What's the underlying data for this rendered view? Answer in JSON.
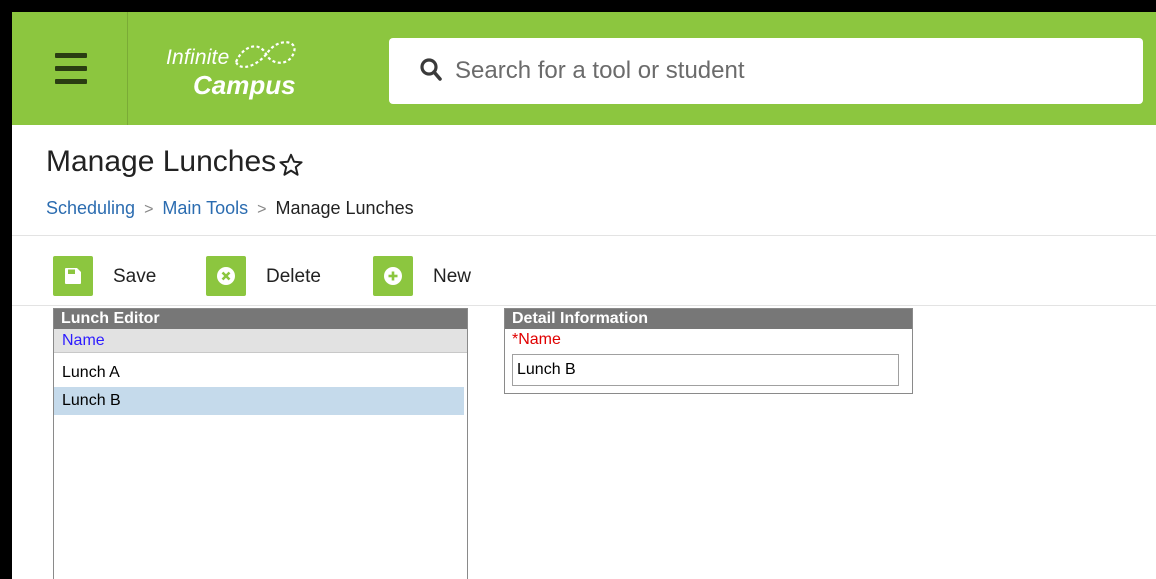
{
  "header": {
    "logo_line1": "Infinite",
    "logo_line2": "Campus",
    "search_placeholder": "Search for a tool or student",
    "brand_color": "#8cc63f"
  },
  "page": {
    "title": "Manage Lunches",
    "breadcrumb": [
      "Scheduling",
      "Main Tools",
      "Manage Lunches"
    ]
  },
  "toolbar": {
    "save_label": "Save",
    "delete_label": "Delete",
    "new_label": "New"
  },
  "lunch_editor": {
    "title": "Lunch Editor",
    "column_header": "Name",
    "rows": [
      "Lunch A",
      "Lunch B"
    ],
    "selected_row": "Lunch B"
  },
  "detail": {
    "title": "Detail Information",
    "name_label": "*Name",
    "name_value": "Lunch B"
  }
}
